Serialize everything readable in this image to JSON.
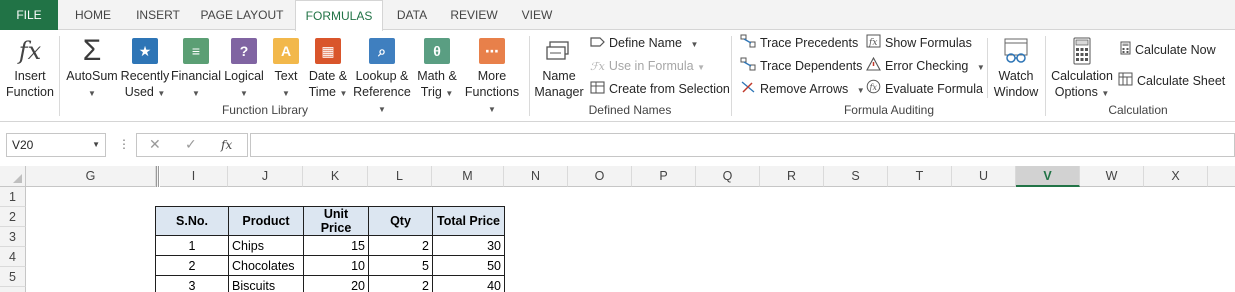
{
  "tabs": {
    "file": "FILE",
    "home": "HOME",
    "insert": "INSERT",
    "page_layout": "PAGE LAYOUT",
    "formulas": "FORMULAS",
    "data": "DATA",
    "review": "REVIEW",
    "view": "VIEW"
  },
  "ribbon": {
    "insert_function": [
      "Insert",
      "Function"
    ],
    "autosum": "AutoSum",
    "recently_used": [
      "Recently",
      "Used"
    ],
    "financial": "Financial",
    "logical": "Logical",
    "text": "Text",
    "date_time": [
      "Date &",
      "Time"
    ],
    "lookup_reference": [
      "Lookup &",
      "Reference"
    ],
    "math_trig": [
      "Math &",
      "Trig"
    ],
    "more_functions": [
      "More",
      "Functions"
    ],
    "function_library_label": "Function Library",
    "name_manager": [
      "Name",
      "Manager"
    ],
    "define_name": "Define Name",
    "use_in_formula": "Use in Formula",
    "create_from_selection": "Create from Selection",
    "defined_names_label": "Defined Names",
    "trace_precedents": "Trace Precedents",
    "trace_dependents": "Trace Dependents",
    "remove_arrows": "Remove Arrows",
    "show_formulas": "Show Formulas",
    "error_checking": "Error Checking",
    "evaluate_formula": "Evaluate Formula",
    "watch_window": [
      "Watch",
      "Window"
    ],
    "formula_auditing_label": "Formula Auditing",
    "calculation_options": [
      "Calculation",
      "Options"
    ],
    "calculate_now": "Calculate Now",
    "calculate_sheet": "Calculate Sheet",
    "calculation_label": "Calculation"
  },
  "formula_bar": {
    "name_box": "V20",
    "fx": "fx",
    "formula": ""
  },
  "grid": {
    "columns": [
      "G",
      "I",
      "J",
      "K",
      "L",
      "M",
      "N",
      "O",
      "P",
      "Q",
      "R",
      "S",
      "T",
      "U",
      "V",
      "W",
      "X"
    ],
    "selected_column": "V",
    "rows": [
      "1",
      "2",
      "3",
      "4",
      "5"
    ]
  },
  "table": {
    "headers": [
      "S.No.",
      "Product",
      "Unit Price",
      "Qty",
      "Total Price"
    ],
    "rows": [
      [
        "1",
        "Chips",
        "15",
        "2",
        "30"
      ],
      [
        "2",
        "Chocolates",
        "10",
        "5",
        "50"
      ],
      [
        "3",
        "Biscuits",
        "20",
        "2",
        "40"
      ]
    ]
  },
  "colors": {
    "excel_green": "#217346",
    "table_header_fill": "#dce6f1"
  }
}
